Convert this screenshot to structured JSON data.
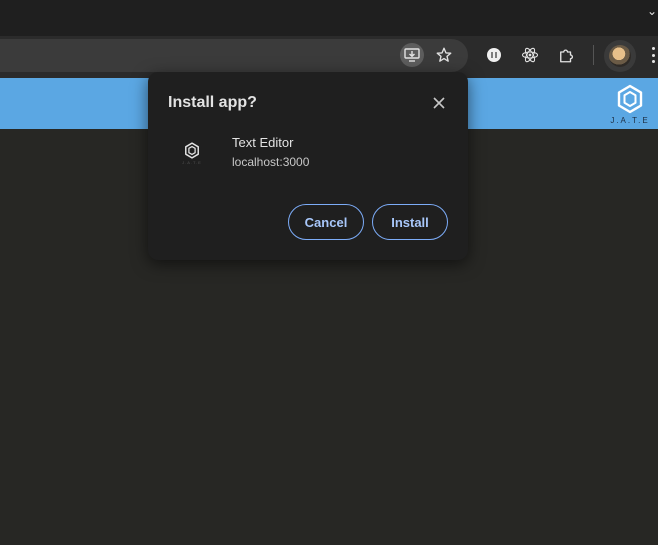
{
  "browser": {
    "toolbar_icons": [
      "install-app-icon",
      "bookmark-star-icon",
      "extension-ublock-icon",
      "extension-react-icon",
      "extensions-puzzle-icon",
      "profile-avatar",
      "more-menu-icon"
    ]
  },
  "app_header": {
    "logo_text": "J.A.T.E"
  },
  "dialog": {
    "title": "Install app?",
    "app_name": "Text Editor",
    "app_origin": "localhost:3000",
    "app_icon_text": "J.A.T.E",
    "cancel_label": "Cancel",
    "install_label": "Install"
  },
  "colors": {
    "page_bg": "#272724",
    "header_bg": "#5ba7e3",
    "dialog_bg": "#1f1f1f",
    "button_text": "#a8c7fa",
    "button_border": "#7cacf8"
  }
}
